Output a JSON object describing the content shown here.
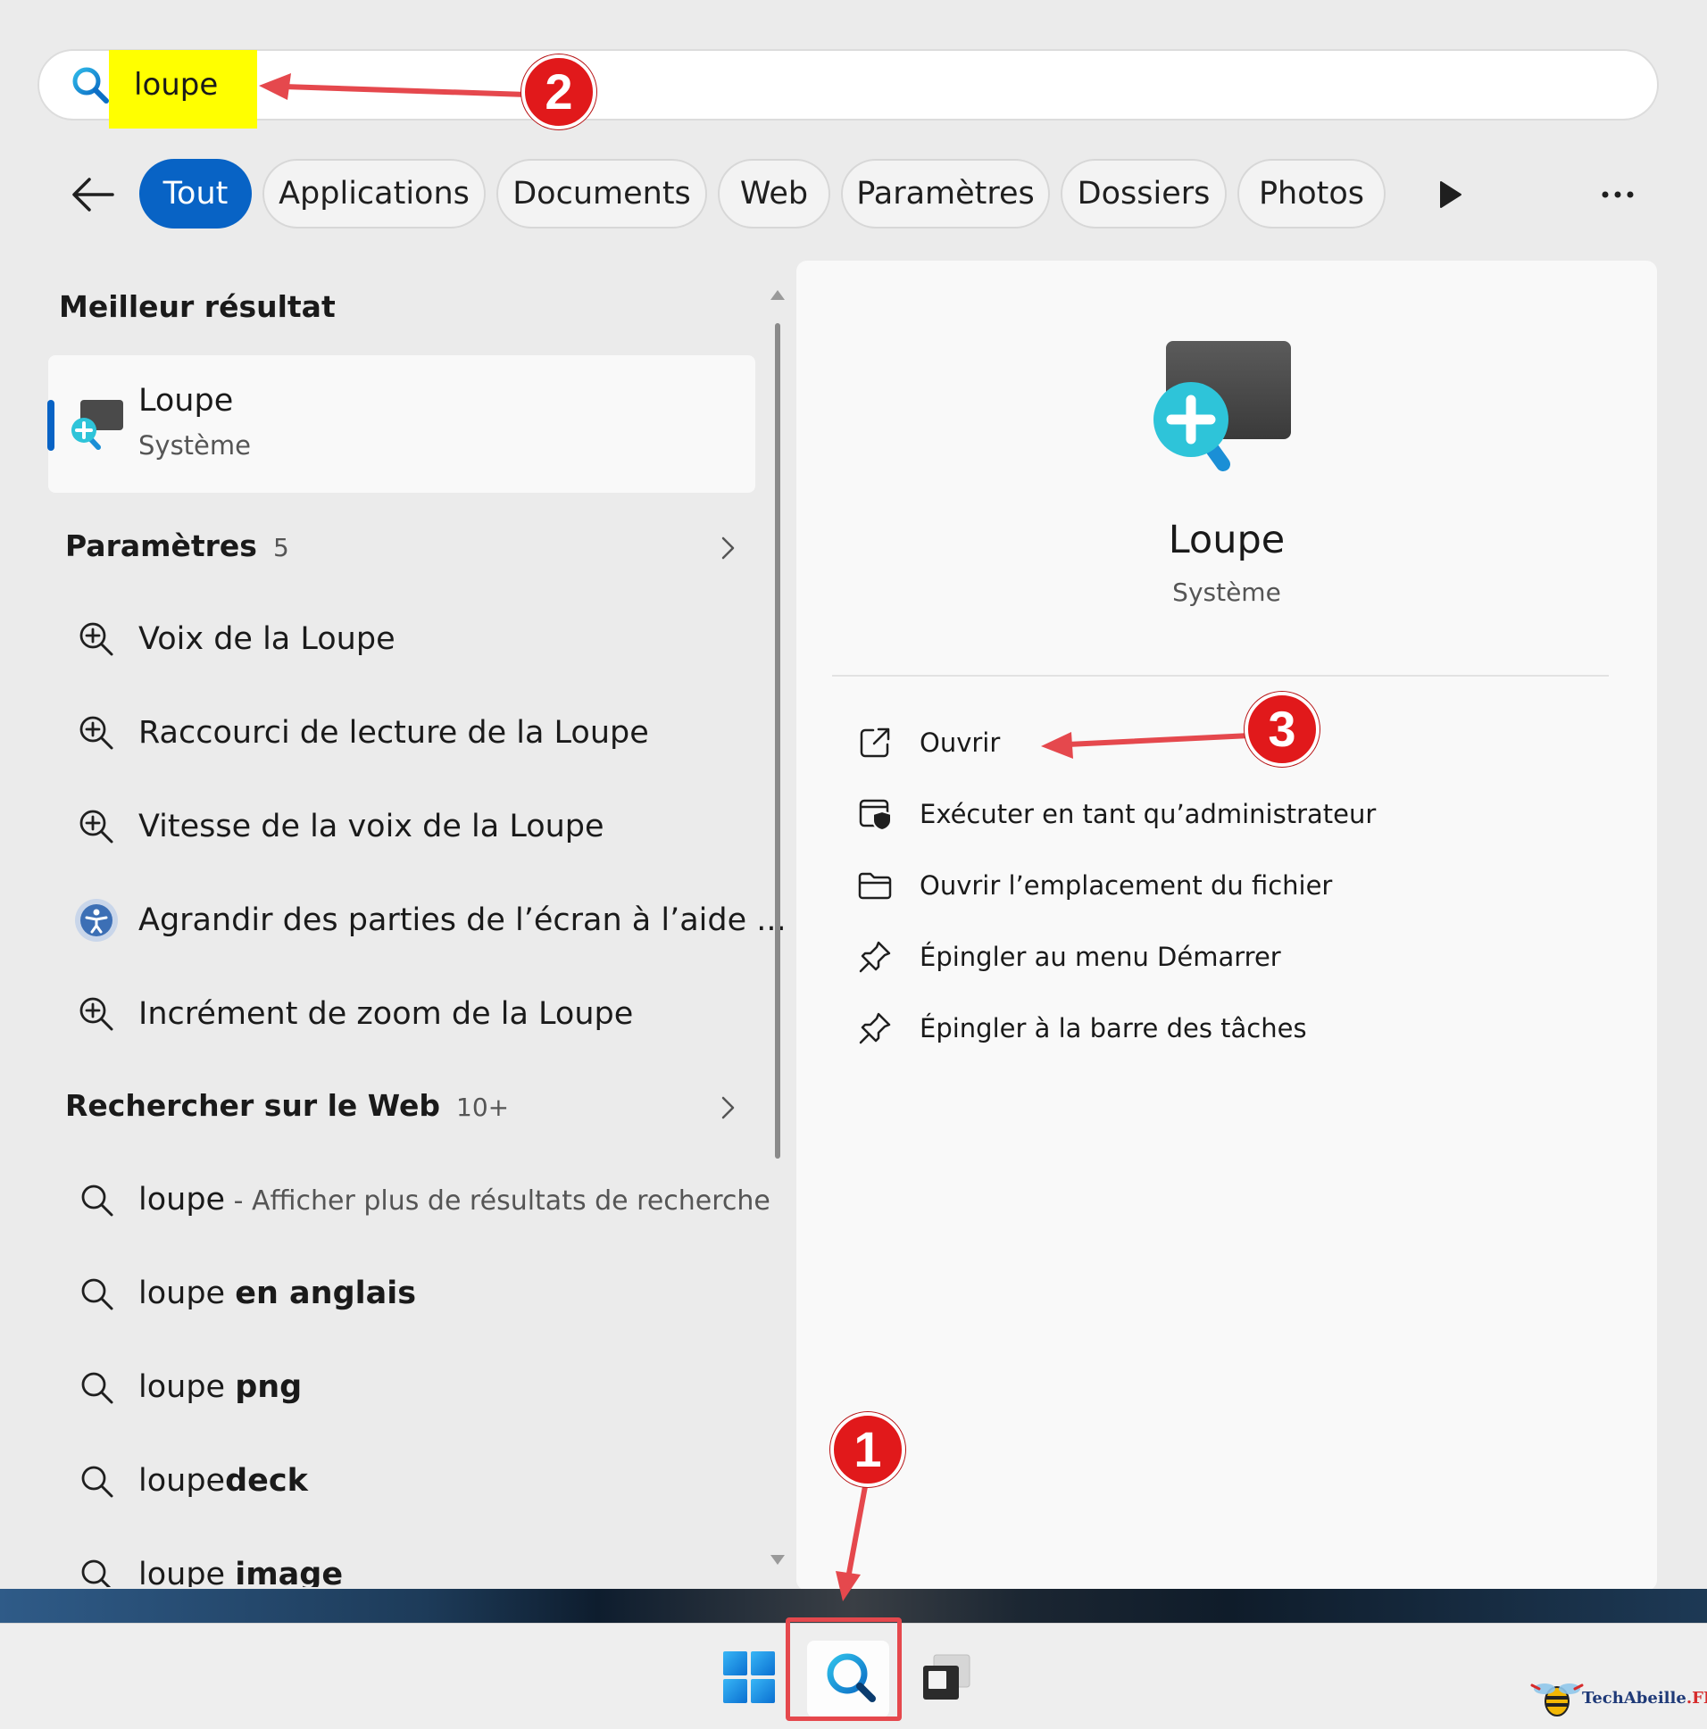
{
  "search": {
    "query": "loupe"
  },
  "filters": {
    "chips": [
      {
        "label": "Tout",
        "active": true
      },
      {
        "label": "Applications",
        "active": false
      },
      {
        "label": "Documents",
        "active": false
      },
      {
        "label": "Web",
        "active": false
      },
      {
        "label": "Paramètres",
        "active": false
      },
      {
        "label": "Dossiers",
        "active": false
      },
      {
        "label": "Photos",
        "active": false
      }
    ]
  },
  "best_match": {
    "heading": "Meilleur résultat",
    "app": {
      "name": "Loupe",
      "type": "Système",
      "icon": "magnifier-app-icon"
    }
  },
  "settings_section": {
    "heading": "Paramètres",
    "count": "5",
    "items": [
      {
        "label": "Voix de la Loupe",
        "icon": "zoom-in-icon"
      },
      {
        "label": "Raccourci de lecture de la Loupe",
        "icon": "zoom-in-icon"
      },
      {
        "label": "Vitesse de la voix de la Loupe",
        "icon": "zoom-in-icon"
      },
      {
        "label": "Agrandir des parties de l’écran à l’aide ...",
        "icon": "accessibility-icon"
      },
      {
        "label": "Incrément de zoom de la Loupe",
        "icon": "zoom-in-icon"
      }
    ]
  },
  "web_section": {
    "heading": "Rechercher sur le Web",
    "count": "10+",
    "items": [
      {
        "prefix": "loupe",
        "suffix": "",
        "note": " - Afficher plus de résultats de recherche"
      },
      {
        "prefix": "loupe ",
        "suffix": "en anglais",
        "note": ""
      },
      {
        "prefix": "loupe ",
        "suffix": "png",
        "note": ""
      },
      {
        "prefix": "loupe",
        "suffix": "deck",
        "note": ""
      },
      {
        "prefix": "loupe ",
        "suffix": "image",
        "note": ""
      }
    ]
  },
  "detail": {
    "name": "Loupe",
    "type": "Système",
    "actions": [
      {
        "label": "Ouvrir",
        "icon": "open-external-icon"
      },
      {
        "label": "Exécuter en tant qu’administrateur",
        "icon": "admin-shield-icon"
      },
      {
        "label": "Ouvrir l’emplacement du fichier",
        "icon": "folder-icon"
      },
      {
        "label": "Épingler au menu Démarrer",
        "icon": "pin-icon"
      },
      {
        "label": "Épingler à la barre des tâches",
        "icon": "pin-icon"
      }
    ]
  },
  "annotations": {
    "badge_1": "1",
    "badge_2": "2",
    "badge_3": "3",
    "color": "#e5484d"
  },
  "watermark": {
    "brand": "TechAbeille",
    "tld": ".FR"
  },
  "colors": {
    "accent": "#0863c5",
    "highlight": "#ffff00",
    "badge": "#e1191b"
  }
}
